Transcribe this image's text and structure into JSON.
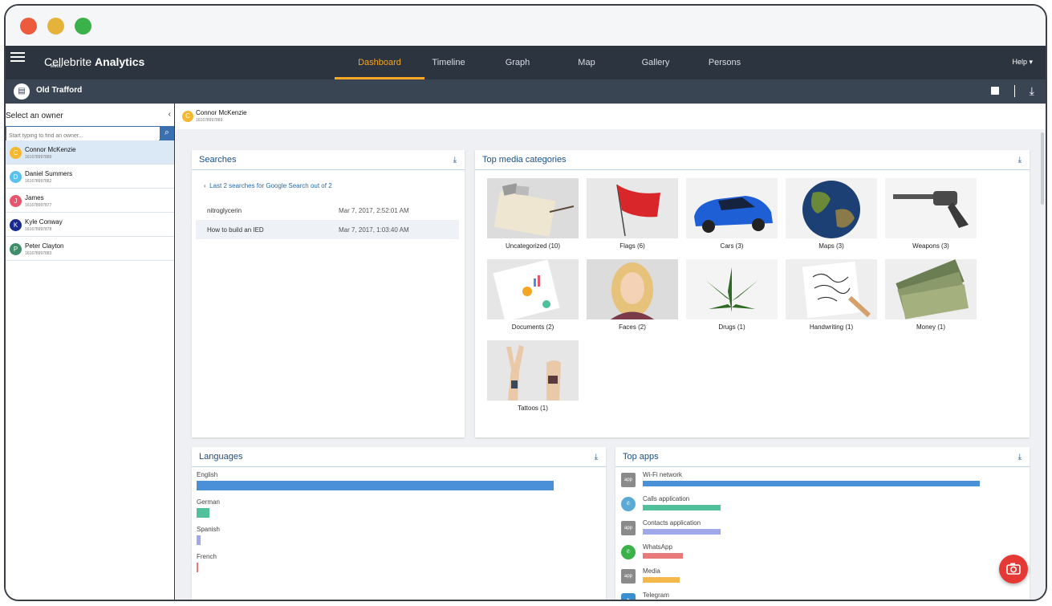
{
  "app": {
    "brand_plain": "Cellebrite",
    "brand_bold": "Analytics",
    "menu_label": "Menu",
    "help_label": "Help ▾"
  },
  "nav": {
    "tabs": [
      "Dashboard",
      "Timeline",
      "Graph",
      "Map",
      "Gallery",
      "Persons"
    ],
    "active": "Dashboard"
  },
  "case": {
    "name": "Old Trafford"
  },
  "sidebar": {
    "heading": "Select an owner",
    "search_placeholder": "Start typing to find an owner...",
    "owners": [
      {
        "initial": "C",
        "name": "Connor McKenzie",
        "number": "161678997889",
        "color": "#f5b82e",
        "selected": true
      },
      {
        "initial": "D",
        "name": "Daniel Summers",
        "number": "161678997882",
        "color": "#5bc0eb",
        "selected": false
      },
      {
        "initial": "J",
        "name": "James",
        "number": "161678997877",
        "color": "#e8546b",
        "selected": false
      },
      {
        "initial": "K",
        "name": "Kyle Conway",
        "number": "161678997878",
        "color": "#1a2a8c",
        "selected": false
      },
      {
        "initial": "P",
        "name": "Peter Clayton",
        "number": "161678997883",
        "color": "#3e8e6a",
        "selected": false
      }
    ]
  },
  "current_owner": {
    "initial": "C",
    "name": "Connor McKenzie",
    "number": "161678997889"
  },
  "searches": {
    "title": "Searches",
    "nav_text": "Last 2 searches for Google Search out of 2",
    "rows": [
      {
        "query": "nitroglycerin",
        "date": "Mar 7, 2017, 2:52:01 AM"
      },
      {
        "query": "How to build an IED",
        "date": "Mar 7, 2017, 1:03:40 AM"
      }
    ]
  },
  "media": {
    "title": "Top media categories",
    "categories": [
      {
        "label": "Uncategorized (10)",
        "icon": "notebook-photos-image"
      },
      {
        "label": "Flags (6)",
        "icon": "red-flag-image"
      },
      {
        "label": "Cars (3)",
        "icon": "blue-car-image"
      },
      {
        "label": "Maps (3)",
        "icon": "globe-image"
      },
      {
        "label": "Weapons (3)",
        "icon": "revolver-image"
      },
      {
        "label": "Documents (2)",
        "icon": "charts-document-image"
      },
      {
        "label": "Faces (2)",
        "icon": "blonde-woman-image"
      },
      {
        "label": "Drugs (1)",
        "icon": "cannabis-leaf-image"
      },
      {
        "label": "Handwriting (1)",
        "icon": "handwriting-image"
      },
      {
        "label": "Money (1)",
        "icon": "dollar-bills-image"
      },
      {
        "label": "Tattoos (1)",
        "icon": "tattooed-hands-image"
      }
    ]
  },
  "languages": {
    "title": "Languages",
    "items": [
      {
        "name": "English",
        "share": 1.0,
        "color": "#4a90d9"
      },
      {
        "name": "German",
        "share": 0.036,
        "color": "#52c09a"
      },
      {
        "name": "Spanish",
        "share": 0.011,
        "color": "#9fa8e8"
      },
      {
        "name": "French",
        "share": 0.004,
        "color": "#e87a7a"
      }
    ]
  },
  "top_apps": {
    "title": "Top apps",
    "items": [
      {
        "name": "Wi-Fi network",
        "icon": "app",
        "share": 1.0,
        "color": "#4a90d9"
      },
      {
        "name": "Calls application",
        "icon": "phone",
        "share": 0.23,
        "color": "#52c09a"
      },
      {
        "name": "Contacts application",
        "icon": "app",
        "share": 0.23,
        "color": "#9fa8e8"
      },
      {
        "name": "WhatsApp",
        "icon": "whatsapp",
        "share": 0.12,
        "color": "#e87a7a"
      },
      {
        "name": "Media",
        "icon": "app",
        "share": 0.11,
        "color": "#f5b84a"
      },
      {
        "name": "Telegram",
        "icon": "telegram",
        "share": 0.11,
        "color": "#8dc96a"
      }
    ]
  }
}
